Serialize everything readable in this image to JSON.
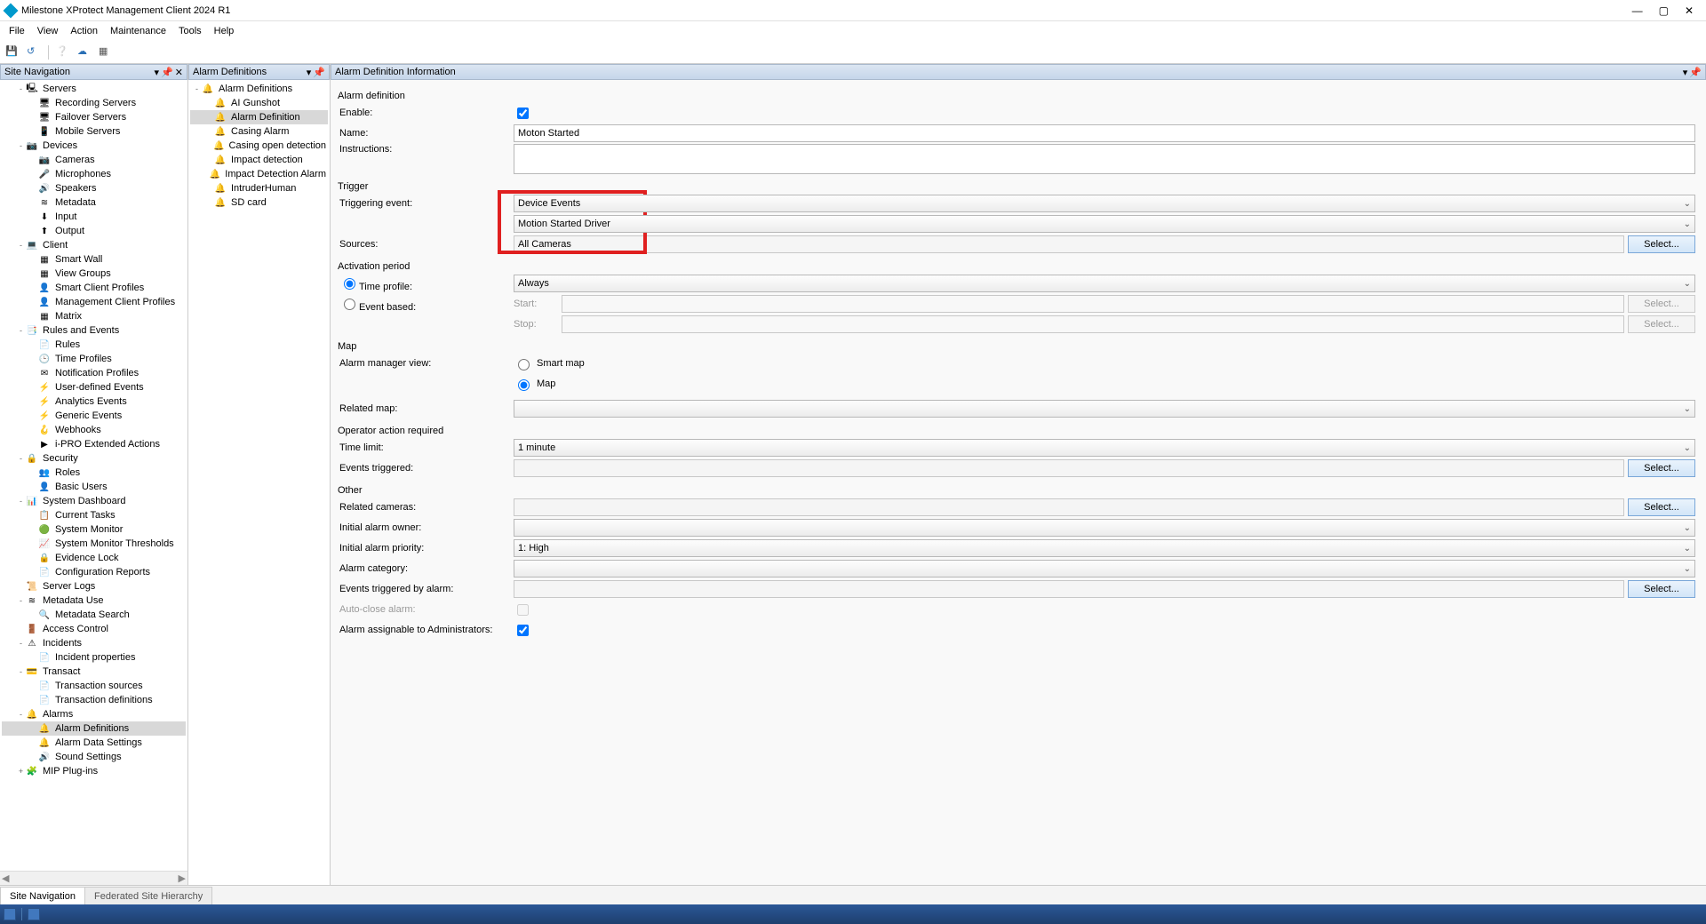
{
  "window": {
    "title": "Milestone XProtect Management Client 2024 R1"
  },
  "menubar": [
    "File",
    "View",
    "Action",
    "Maintenance",
    "Tools",
    "Help"
  ],
  "panes": {
    "nav_title": "Site Navigation",
    "mid_title": "Alarm Definitions",
    "form_title": "Alarm Definition Information"
  },
  "nav_tree": [
    {
      "d": 1,
      "exp": "-",
      "icon": "🖳",
      "label": "Servers"
    },
    {
      "d": 2,
      "exp": "",
      "icon": "🖥",
      "label": "Recording Servers"
    },
    {
      "d": 2,
      "exp": "",
      "icon": "🖥",
      "label": "Failover Servers"
    },
    {
      "d": 2,
      "exp": "",
      "icon": "📱",
      "label": "Mobile Servers"
    },
    {
      "d": 1,
      "exp": "-",
      "icon": "📷",
      "label": "Devices"
    },
    {
      "d": 2,
      "exp": "",
      "icon": "📷",
      "label": "Cameras"
    },
    {
      "d": 2,
      "exp": "",
      "icon": "🎤",
      "label": "Microphones"
    },
    {
      "d": 2,
      "exp": "",
      "icon": "🔊",
      "label": "Speakers"
    },
    {
      "d": 2,
      "exp": "",
      "icon": "≋",
      "label": "Metadata"
    },
    {
      "d": 2,
      "exp": "",
      "icon": "⬇",
      "label": "Input"
    },
    {
      "d": 2,
      "exp": "",
      "icon": "⬆",
      "label": "Output"
    },
    {
      "d": 1,
      "exp": "-",
      "icon": "💻",
      "label": "Client"
    },
    {
      "d": 2,
      "exp": "",
      "icon": "▦",
      "label": "Smart Wall"
    },
    {
      "d": 2,
      "exp": "",
      "icon": "▦",
      "label": "View Groups"
    },
    {
      "d": 2,
      "exp": "",
      "icon": "👤",
      "label": "Smart Client Profiles"
    },
    {
      "d": 2,
      "exp": "",
      "icon": "👤",
      "label": "Management Client Profiles"
    },
    {
      "d": 2,
      "exp": "",
      "icon": "▦",
      "label": "Matrix"
    },
    {
      "d": 1,
      "exp": "-",
      "icon": "📑",
      "label": "Rules and Events"
    },
    {
      "d": 2,
      "exp": "",
      "icon": "📄",
      "label": "Rules"
    },
    {
      "d": 2,
      "exp": "",
      "icon": "🕒",
      "label": "Time Profiles"
    },
    {
      "d": 2,
      "exp": "",
      "icon": "✉",
      "label": "Notification Profiles"
    },
    {
      "d": 2,
      "exp": "",
      "icon": "⚡",
      "label": "User-defined Events"
    },
    {
      "d": 2,
      "exp": "",
      "icon": "⚡",
      "label": "Analytics Events"
    },
    {
      "d": 2,
      "exp": "",
      "icon": "⚡",
      "label": "Generic Events"
    },
    {
      "d": 2,
      "exp": "",
      "icon": "🪝",
      "label": "Webhooks"
    },
    {
      "d": 2,
      "exp": "",
      "icon": "▶",
      "label": "i-PRO Extended Actions"
    },
    {
      "d": 1,
      "exp": "-",
      "icon": "🔒",
      "label": "Security"
    },
    {
      "d": 2,
      "exp": "",
      "icon": "👥",
      "label": "Roles"
    },
    {
      "d": 2,
      "exp": "",
      "icon": "👤",
      "label": "Basic Users"
    },
    {
      "d": 1,
      "exp": "-",
      "icon": "📊",
      "label": "System Dashboard"
    },
    {
      "d": 2,
      "exp": "",
      "icon": "📋",
      "label": "Current Tasks"
    },
    {
      "d": 2,
      "exp": "",
      "icon": "🟢",
      "label": "System Monitor"
    },
    {
      "d": 2,
      "exp": "",
      "icon": "📈",
      "label": "System Monitor Thresholds"
    },
    {
      "d": 2,
      "exp": "",
      "icon": "🔒",
      "label": "Evidence Lock"
    },
    {
      "d": 2,
      "exp": "",
      "icon": "📄",
      "label": "Configuration Reports"
    },
    {
      "d": 1,
      "exp": "",
      "icon": "📜",
      "label": "Server Logs"
    },
    {
      "d": 1,
      "exp": "-",
      "icon": "≋",
      "label": "Metadata Use"
    },
    {
      "d": 2,
      "exp": "",
      "icon": "🔍",
      "label": "Metadata Search"
    },
    {
      "d": 1,
      "exp": "",
      "icon": "🚪",
      "label": "Access Control"
    },
    {
      "d": 1,
      "exp": "-",
      "icon": "⚠",
      "label": "Incidents"
    },
    {
      "d": 2,
      "exp": "",
      "icon": "📄",
      "label": "Incident properties"
    },
    {
      "d": 1,
      "exp": "-",
      "icon": "💳",
      "label": "Transact"
    },
    {
      "d": 2,
      "exp": "",
      "icon": "📄",
      "label": "Transaction sources"
    },
    {
      "d": 2,
      "exp": "",
      "icon": "📄",
      "label": "Transaction definitions"
    },
    {
      "d": 1,
      "exp": "-",
      "icon": "🔔",
      "label": "Alarms"
    },
    {
      "d": 2,
      "exp": "",
      "icon": "🔔",
      "label": "Alarm Definitions",
      "sel": true
    },
    {
      "d": 2,
      "exp": "",
      "icon": "🔔",
      "label": "Alarm Data Settings"
    },
    {
      "d": 2,
      "exp": "",
      "icon": "🔊",
      "label": "Sound Settings"
    },
    {
      "d": 1,
      "exp": "+",
      "icon": "🧩",
      "label": "MIP Plug-ins"
    }
  ],
  "mid_tree": [
    {
      "d": 0,
      "exp": "-",
      "icon": "🔔",
      "label": "Alarm Definitions"
    },
    {
      "d": 1,
      "exp": "",
      "icon": "🔔",
      "label": "AI Gunshot"
    },
    {
      "d": 1,
      "exp": "",
      "icon": "🔔",
      "label": "Alarm Definition",
      "sel": true
    },
    {
      "d": 1,
      "exp": "",
      "icon": "🔔",
      "label": "Casing Alarm"
    },
    {
      "d": 1,
      "exp": "",
      "icon": "🔔",
      "label": "Casing open detection"
    },
    {
      "d": 1,
      "exp": "",
      "icon": "🔔",
      "label": "Impact detection"
    },
    {
      "d": 1,
      "exp": "",
      "icon": "🔔",
      "label": "Impact Detection Alarm"
    },
    {
      "d": 1,
      "exp": "",
      "icon": "🔔",
      "label": "IntruderHuman"
    },
    {
      "d": 1,
      "exp": "",
      "icon": "🔔",
      "label": "SD card"
    }
  ],
  "tabs": {
    "active": "Site Navigation",
    "inactive": "Federated Site Hierarchy"
  },
  "form": {
    "sections": {
      "def": "Alarm definition",
      "trigger": "Trigger",
      "activation": "Activation period",
      "map": "Map",
      "operator": "Operator action required",
      "other": "Other"
    },
    "labels": {
      "enable": "Enable:",
      "name": "Name:",
      "instructions": "Instructions:",
      "triggering": "Triggering event:",
      "sources": "Sources:",
      "time_profile": "Time profile:",
      "event_based": "Event based:",
      "start": "Start:",
      "stop": "Stop:",
      "manager_view": "Alarm manager view:",
      "smart_map": "Smart map",
      "map_opt": "Map",
      "related_map": "Related map:",
      "time_limit": "Time limit:",
      "events_triggered": "Events triggered:",
      "related_cameras": "Related cameras:",
      "initial_owner": "Initial alarm owner:",
      "initial_priority": "Initial alarm priority:",
      "category": "Alarm category:",
      "events_by_alarm": "Events triggered by alarm:",
      "auto_close": "Auto-close alarm:",
      "assignable": "Alarm assignable to Administrators:"
    },
    "values": {
      "name": "Moton Started",
      "instructions": "",
      "triggering_event": "Device Events",
      "triggering_sub": "Motion Started Driver",
      "sources": "All Cameras",
      "time_profile": "Always",
      "start": "",
      "stop": "",
      "related_map": "",
      "time_limit": "1 minute",
      "events_triggered": "",
      "related_cameras": "",
      "initial_owner": "",
      "initial_priority": "1: High",
      "category": "",
      "events_by_alarm": ""
    },
    "buttons": {
      "select": "Select..."
    }
  }
}
